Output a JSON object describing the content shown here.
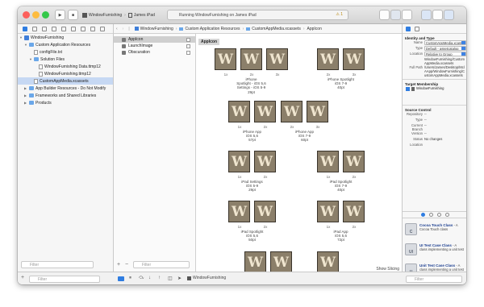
{
  "toolbar": {
    "scheme_name": "WindowFurnishing",
    "device": "James iPad",
    "activity": "Running WindowFurnishing on James iPad",
    "warning_count": "1"
  },
  "navigator": {
    "items": [
      {
        "label": "WindowFurnishing",
        "kind": "project",
        "indent": 0,
        "open": true,
        "selected": false
      },
      {
        "label": "Custom Application Resources",
        "kind": "folder",
        "indent": 1,
        "open": true,
        "selected": false
      },
      {
        "label": "configFile.txt",
        "kind": "file",
        "indent": 2,
        "open": false,
        "selected": false
      },
      {
        "label": "Solution Files",
        "kind": "folder",
        "indent": 2,
        "open": true,
        "selected": false
      },
      {
        "label": "WindowFurnishing Data.ttmp12",
        "kind": "file",
        "indent": 3,
        "open": false,
        "selected": false
      },
      {
        "label": "WindowFurnishing.ttmp12",
        "kind": "file",
        "indent": 3,
        "open": false,
        "selected": false
      },
      {
        "label": "CustomAppMedia.xcassets",
        "kind": "file",
        "indent": 2,
        "open": false,
        "selected": true
      },
      {
        "label": "App Builder Resources - Do Not Modify",
        "kind": "folder",
        "indent": 1,
        "open": false,
        "selected": false
      },
      {
        "label": "Frameworks and Shared Libraries",
        "kind": "folder",
        "indent": 1,
        "open": false,
        "selected": false
      },
      {
        "label": "Products",
        "kind": "folder",
        "indent": 1,
        "open": false,
        "selected": false
      }
    ],
    "filter_placeholder": "Filter"
  },
  "jumpbar": {
    "crumbs": [
      "WindowFurnishing",
      "Custom Application Resources",
      "CustomAppMedia.xcassets",
      "AppIcon"
    ]
  },
  "assets": {
    "sets": [
      {
        "label": "AppIcon",
        "selected": true
      },
      {
        "label": "LaunchImage",
        "selected": false
      },
      {
        "label": "Obscuration",
        "selected": false
      }
    ],
    "filter_placeholder": "Filter"
  },
  "canvas": {
    "title": "AppIcon",
    "monogram": "W",
    "groups": [
      {
        "label": [
          "iPhone",
          "Spotlight - iOS 5,6",
          "Settings - iOS 5-9",
          "29pt"
        ],
        "scales": [
          "1x",
          "2x",
          "3x"
        ]
      },
      {
        "label": [
          "iPhone Spotlight",
          "iOS 7-9",
          "40pt"
        ],
        "scales": [
          "2x",
          "3x"
        ]
      },
      {
        "label": [
          "iPhone App",
          "iOS 5,6",
          "57pt"
        ],
        "scales": [
          "1x",
          "2x"
        ]
      },
      {
        "label": [
          "iPhone App",
          "iOS 7-9",
          "60pt"
        ],
        "scales": [
          "2x",
          "3x"
        ]
      },
      {
        "label": [
          "iPad Settings",
          "iOS 5-9",
          "29pt"
        ],
        "scales": [
          "1x",
          "2x"
        ]
      },
      {
        "label": [
          "iPad Spotlight",
          "iOS 7-9",
          "40pt"
        ],
        "scales": [
          "1x",
          "2x"
        ]
      },
      {
        "label": [
          "iPad Spotlight",
          "iOS 5,6",
          "50pt"
        ],
        "scales": [
          "1x",
          "2x"
        ]
      },
      {
        "label": [
          "iPad App",
          "iOS 5,6",
          "72pt"
        ],
        "scales": [
          "1x",
          "2x"
        ]
      },
      {
        "label": [],
        "scales": []
      },
      {
        "label": [],
        "scales": []
      }
    ],
    "show_slicing": "Show Slicing"
  },
  "inspector": {
    "identity": {
      "header": "Identity and Type",
      "name_label": "Name",
      "name_value": "CustomAppMedia.xcassets",
      "type_label": "Type",
      "type_value": "Default - assetcatalog",
      "location_label": "Location",
      "location_value": "Relative to Group",
      "location_path": "WindowFurnishing/CustomAppMedia.xcassets",
      "fullpath_label": "Full Path",
      "fullpath_value": "/Users/James/Desktop/MclAApp/WindowFurnishing/CustomAppMedia.xcassets"
    },
    "target": {
      "header": "Target Membership",
      "item": "WindowFurnishing"
    },
    "source": {
      "header": "Source Control",
      "rows": [
        {
          "k": "Repository",
          "v": "--"
        },
        {
          "k": "Type",
          "v": "--"
        },
        {
          "k": "Current Branch",
          "v": "--"
        },
        {
          "k": "Version",
          "v": "--"
        },
        {
          "k": "Status",
          "v": "No changes"
        },
        {
          "k": "Location",
          "v": ""
        }
      ]
    },
    "library": [
      {
        "icon": "C",
        "title": "Cocoa Touch Class",
        "desc": "- A Cocoa Touch class"
      },
      {
        "icon": "UI",
        "title": "UI Test Case Class",
        "desc": "- A class implementing a unit test"
      },
      {
        "icon": "U",
        "title": "Unit Test Case Class",
        "desc": "- A class implementing a unit test"
      }
    ]
  },
  "statusbar": {
    "filter_placeholder": "Filter",
    "target": "WindowFurnishing",
    "editor_filter": "Filter"
  },
  "colors": {
    "accent": "#2f7de1",
    "icon_bg": "#8b7f6a",
    "icon_fg": "#efe5cf"
  }
}
